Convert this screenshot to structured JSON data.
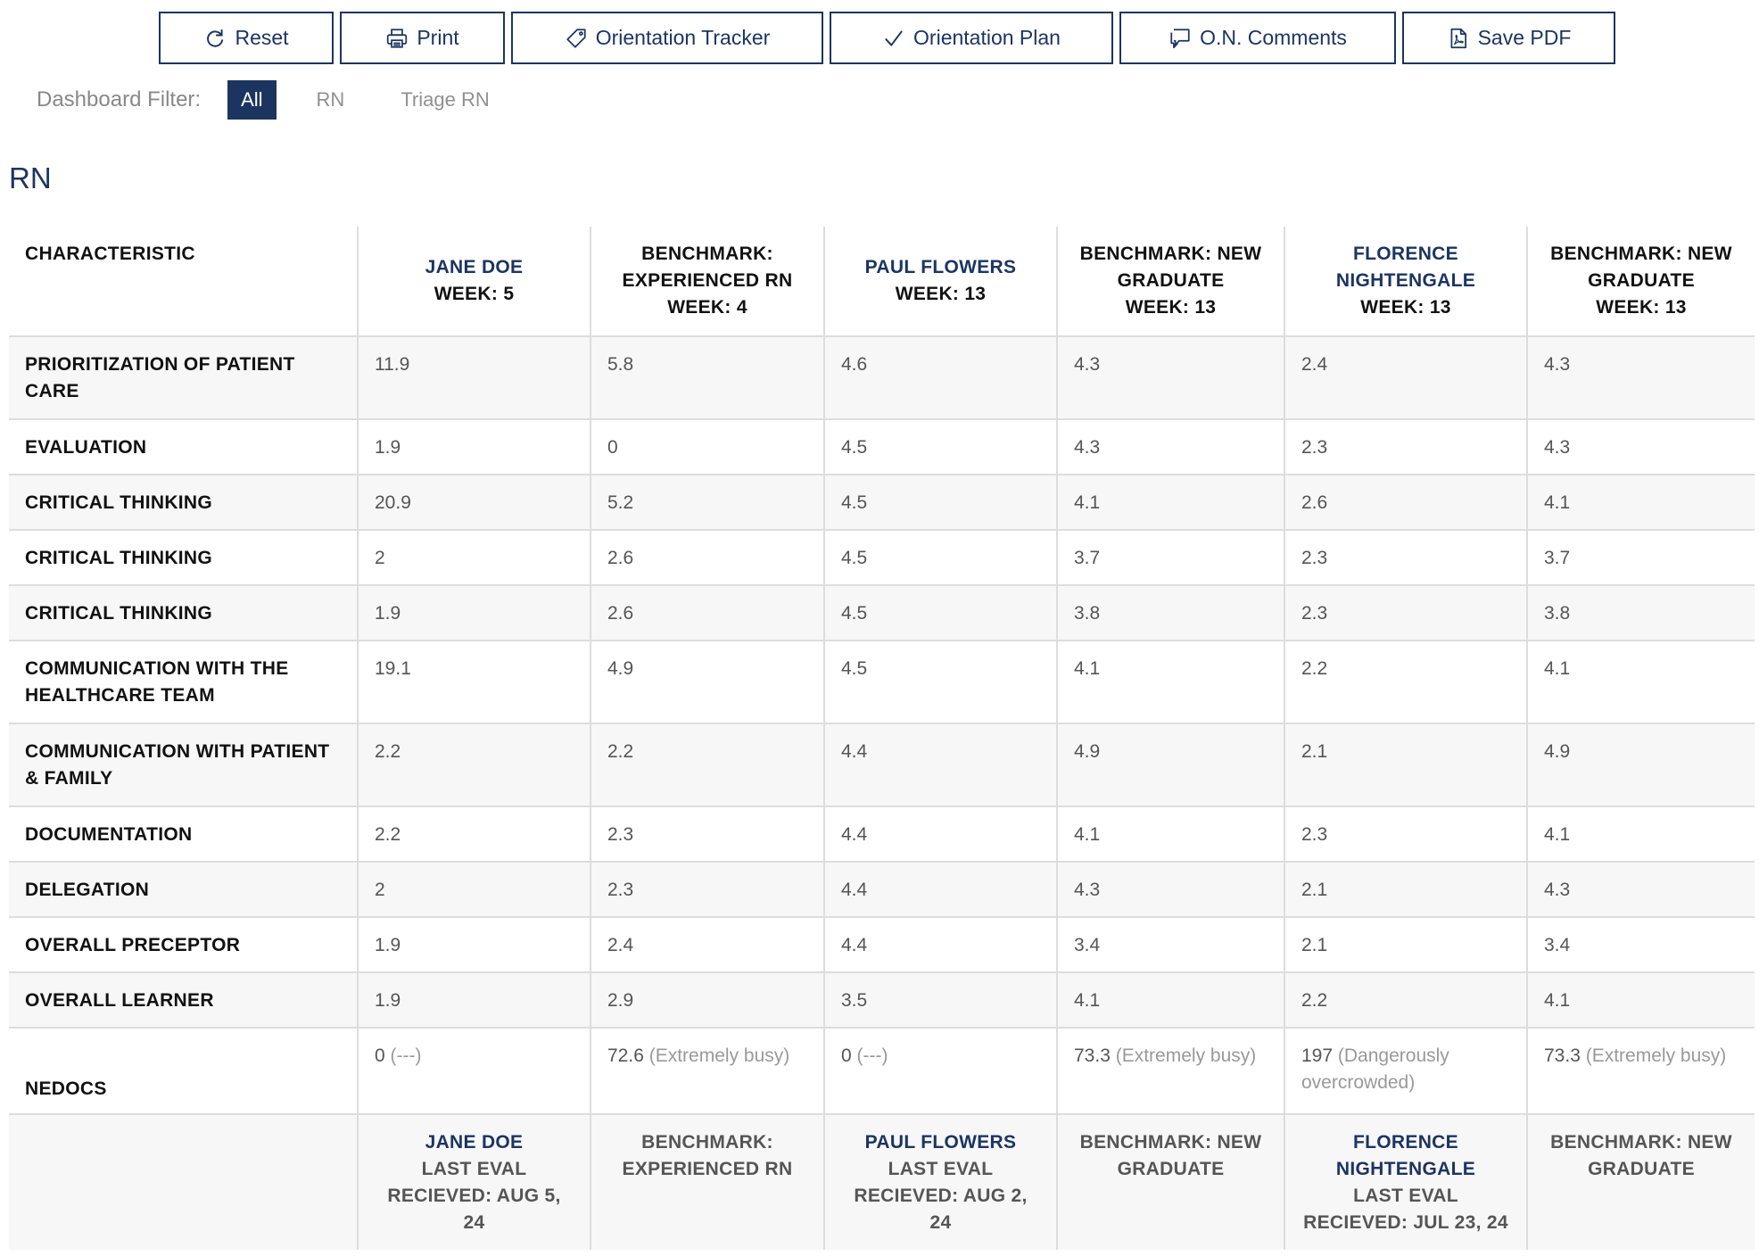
{
  "toolbar": {
    "reset": "Reset",
    "print": "Print",
    "orientation_tracker": "Orientation Tracker",
    "orientation_plan": "Orientation Plan",
    "on_comments": "O.N. Comments",
    "save_pdf": "Save PDF"
  },
  "filter": {
    "label": "Dashboard Filter:",
    "options": [
      "All",
      "RN",
      "Triage RN"
    ],
    "selected": "All"
  },
  "section_title": "RN",
  "table": {
    "header": {
      "characteristic": "CHARACTERISTIC",
      "columns": [
        {
          "name": "JANE DOE",
          "line1": "WEEK: 5",
          "line2": ""
        },
        {
          "name": "",
          "line1": "BENCHMARK: EXPERIENCED RN",
          "line2": "WEEK: 4"
        },
        {
          "name": "PAUL FLOWERS",
          "line1": "WEEK: 13",
          "line2": ""
        },
        {
          "name": "",
          "line1": "BENCHMARK: NEW GRADUATE",
          "line2": "WEEK: 13"
        },
        {
          "name": "FLORENCE NIGHTENGALE",
          "line1": "WEEK: 13",
          "line2": ""
        },
        {
          "name": "",
          "line1": "BENCHMARK: NEW GRADUATE",
          "line2": "WEEK: 13"
        }
      ]
    },
    "rows": [
      {
        "label": "PRIORITIZATION OF PATIENT CARE",
        "values": [
          "11.9",
          "5.8",
          "4.6",
          "4.3",
          "2.4",
          "4.3"
        ]
      },
      {
        "label": "EVALUATION",
        "values": [
          "1.9",
          "0",
          "4.5",
          "4.3",
          "2.3",
          "4.3"
        ]
      },
      {
        "label": "CRITICAL THINKING",
        "values": [
          "20.9",
          "5.2",
          "4.5",
          "4.1",
          "2.6",
          "4.1"
        ]
      },
      {
        "label": "CRITICAL THINKING",
        "values": [
          "2",
          "2.6",
          "4.5",
          "3.7",
          "2.3",
          "3.7"
        ]
      },
      {
        "label": "CRITICAL THINKING",
        "values": [
          "1.9",
          "2.6",
          "4.5",
          "3.8",
          "2.3",
          "3.8"
        ]
      },
      {
        "label": "COMMUNICATION WITH THE HEALTHCARE TEAM",
        "values": [
          "19.1",
          "4.9",
          "4.5",
          "4.1",
          "2.2",
          "4.1"
        ]
      },
      {
        "label": "COMMUNICATION WITH PATIENT & FAMILY",
        "values": [
          "2.2",
          "2.2",
          "4.4",
          "4.9",
          "2.1",
          "4.9"
        ]
      },
      {
        "label": "DOCUMENTATION",
        "values": [
          "2.2",
          "2.3",
          "4.4",
          "4.1",
          "2.3",
          "4.1"
        ]
      },
      {
        "label": "DELEGATION",
        "values": [
          "2",
          "2.3",
          "4.4",
          "4.3",
          "2.1",
          "4.3"
        ]
      },
      {
        "label": "OVERALL PRECEPTOR",
        "values": [
          "1.9",
          "2.4",
          "4.4",
          "3.4",
          "2.1",
          "3.4"
        ]
      },
      {
        "label": "OVERALL LEARNER",
        "values": [
          "1.9",
          "2.9",
          "3.5",
          "4.1",
          "2.2",
          "4.1"
        ]
      }
    ],
    "nedocs": {
      "label": "NEDOCS",
      "values": [
        {
          "score": "0",
          "status": "(---)"
        },
        {
          "score": "72.6",
          "status": "(Extremely busy)"
        },
        {
          "score": "0",
          "status": "(---)"
        },
        {
          "score": "73.3",
          "status": "(Extremely busy)"
        },
        {
          "score": "197",
          "status": "(Dangerously overcrowded)"
        },
        {
          "score": "73.3",
          "status": "(Extremely busy)"
        }
      ]
    },
    "footer": [
      {
        "name": "JANE DOE",
        "text": "LAST EVAL RECIEVED: AUG 5, 24"
      },
      {
        "name": "",
        "text": "BENCHMARK: EXPERIENCED RN"
      },
      {
        "name": "PAUL FLOWERS",
        "text": "LAST EVAL RECIEVED: AUG 2, 24"
      },
      {
        "name": "",
        "text": "BENCHMARK: NEW GRADUATE"
      },
      {
        "name": "FLORENCE NIGHTENGALE",
        "text": "LAST EVAL RECIEVED: JUL 23, 24"
      },
      {
        "name": "",
        "text": "BENCHMARK: NEW GRADUATE"
      }
    ]
  }
}
